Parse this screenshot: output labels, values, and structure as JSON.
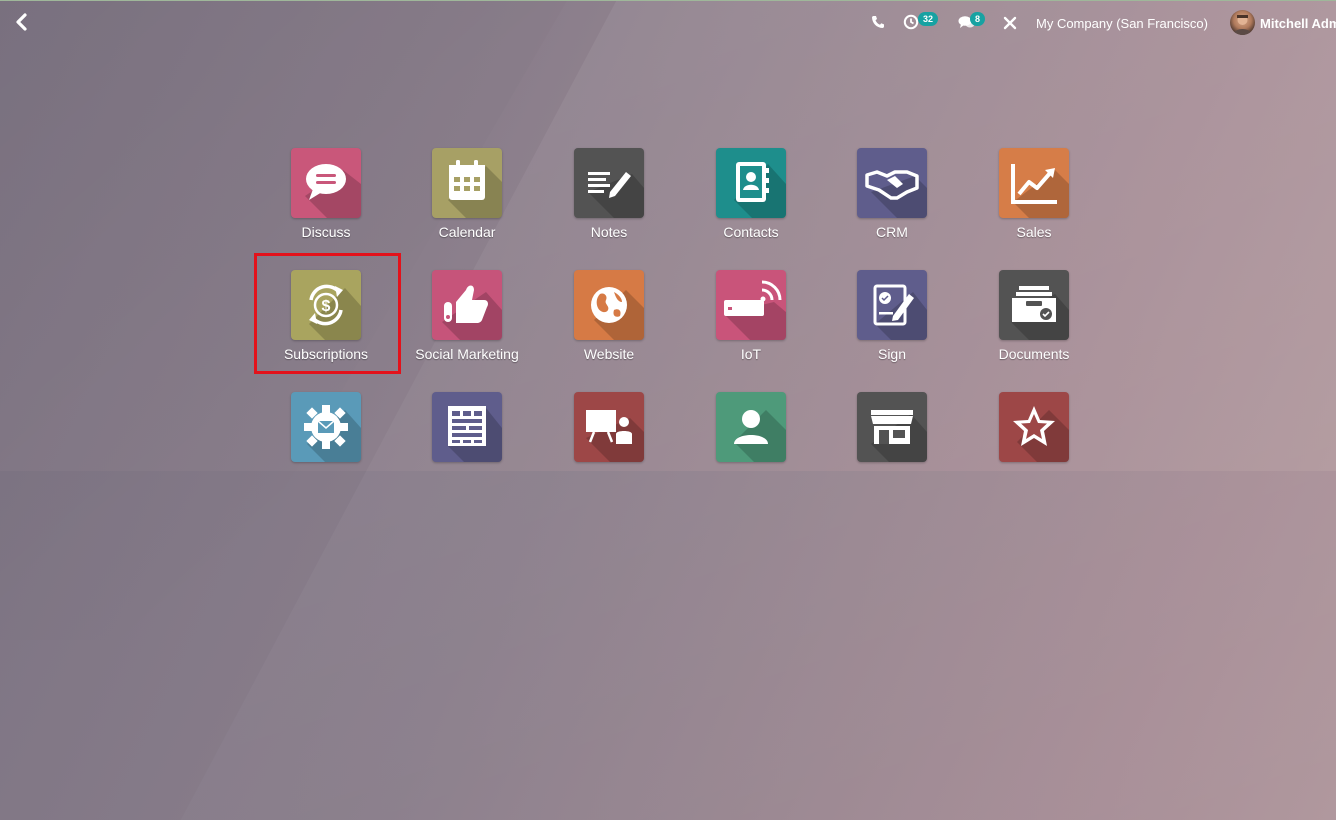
{
  "navbar": {
    "back_icon": "chevron-left-icon",
    "phone_icon": "phone-icon",
    "activity_icon": "clock-icon",
    "activity_count": "32",
    "messages_icon": "chat-bubbles-icon",
    "messages_count": "8",
    "debug_icon": "tools-icon",
    "company": "My Company (San Francisco)",
    "user_name": "Mitchell Admin",
    "accent_color": "#17a2a2"
  },
  "apps": [
    {
      "label": "Discuss",
      "icon": "chat-icon",
      "color": "#c9577a"
    },
    {
      "label": "Calendar",
      "icon": "calendar-icon",
      "color": "#a7a065"
    },
    {
      "label": "Notes",
      "icon": "notes-icon",
      "color": "#535353"
    },
    {
      "label": "Contacts",
      "icon": "address-book-icon",
      "color": "#1e8e8c"
    },
    {
      "label": "CRM",
      "icon": "handshake-icon",
      "color": "#5f5d8c"
    },
    {
      "label": "Sales",
      "icon": "trend-chart-icon",
      "color": "#d67d48"
    },
    {
      "label": "Subscriptions",
      "icon": "recurring-dollar-icon",
      "color": "#a9a45f"
    },
    {
      "label": "Social Marketing",
      "icon": "thumbs-up-icon",
      "color": "#c6547a"
    },
    {
      "label": "Website",
      "icon": "globe-icon",
      "color": "#d67a45"
    },
    {
      "label": "IoT",
      "icon": "iot-signal-icon",
      "color": "#c9547a"
    },
    {
      "label": "Sign",
      "icon": "sign-document-icon",
      "color": "#5f5d8c"
    },
    {
      "label": "Documents",
      "icon": "inbox-box-icon",
      "color": "#535353"
    },
    {
      "label": "",
      "icon": "gear-mail-icon",
      "color": "#5a9ab8"
    },
    {
      "label": "",
      "icon": "spreadsheet-icon",
      "color": "#5f5d8c"
    },
    {
      "label": "",
      "icon": "presentation-icon",
      "color": "#9d4747"
    },
    {
      "label": "",
      "icon": "person-icon",
      "color": "#4e9a7a"
    },
    {
      "label": "",
      "icon": "shop-icon",
      "color": "#535353"
    },
    {
      "label": "",
      "icon": "star-icon",
      "color": "#9d4747"
    }
  ],
  "highlight_color": "#e3121b"
}
